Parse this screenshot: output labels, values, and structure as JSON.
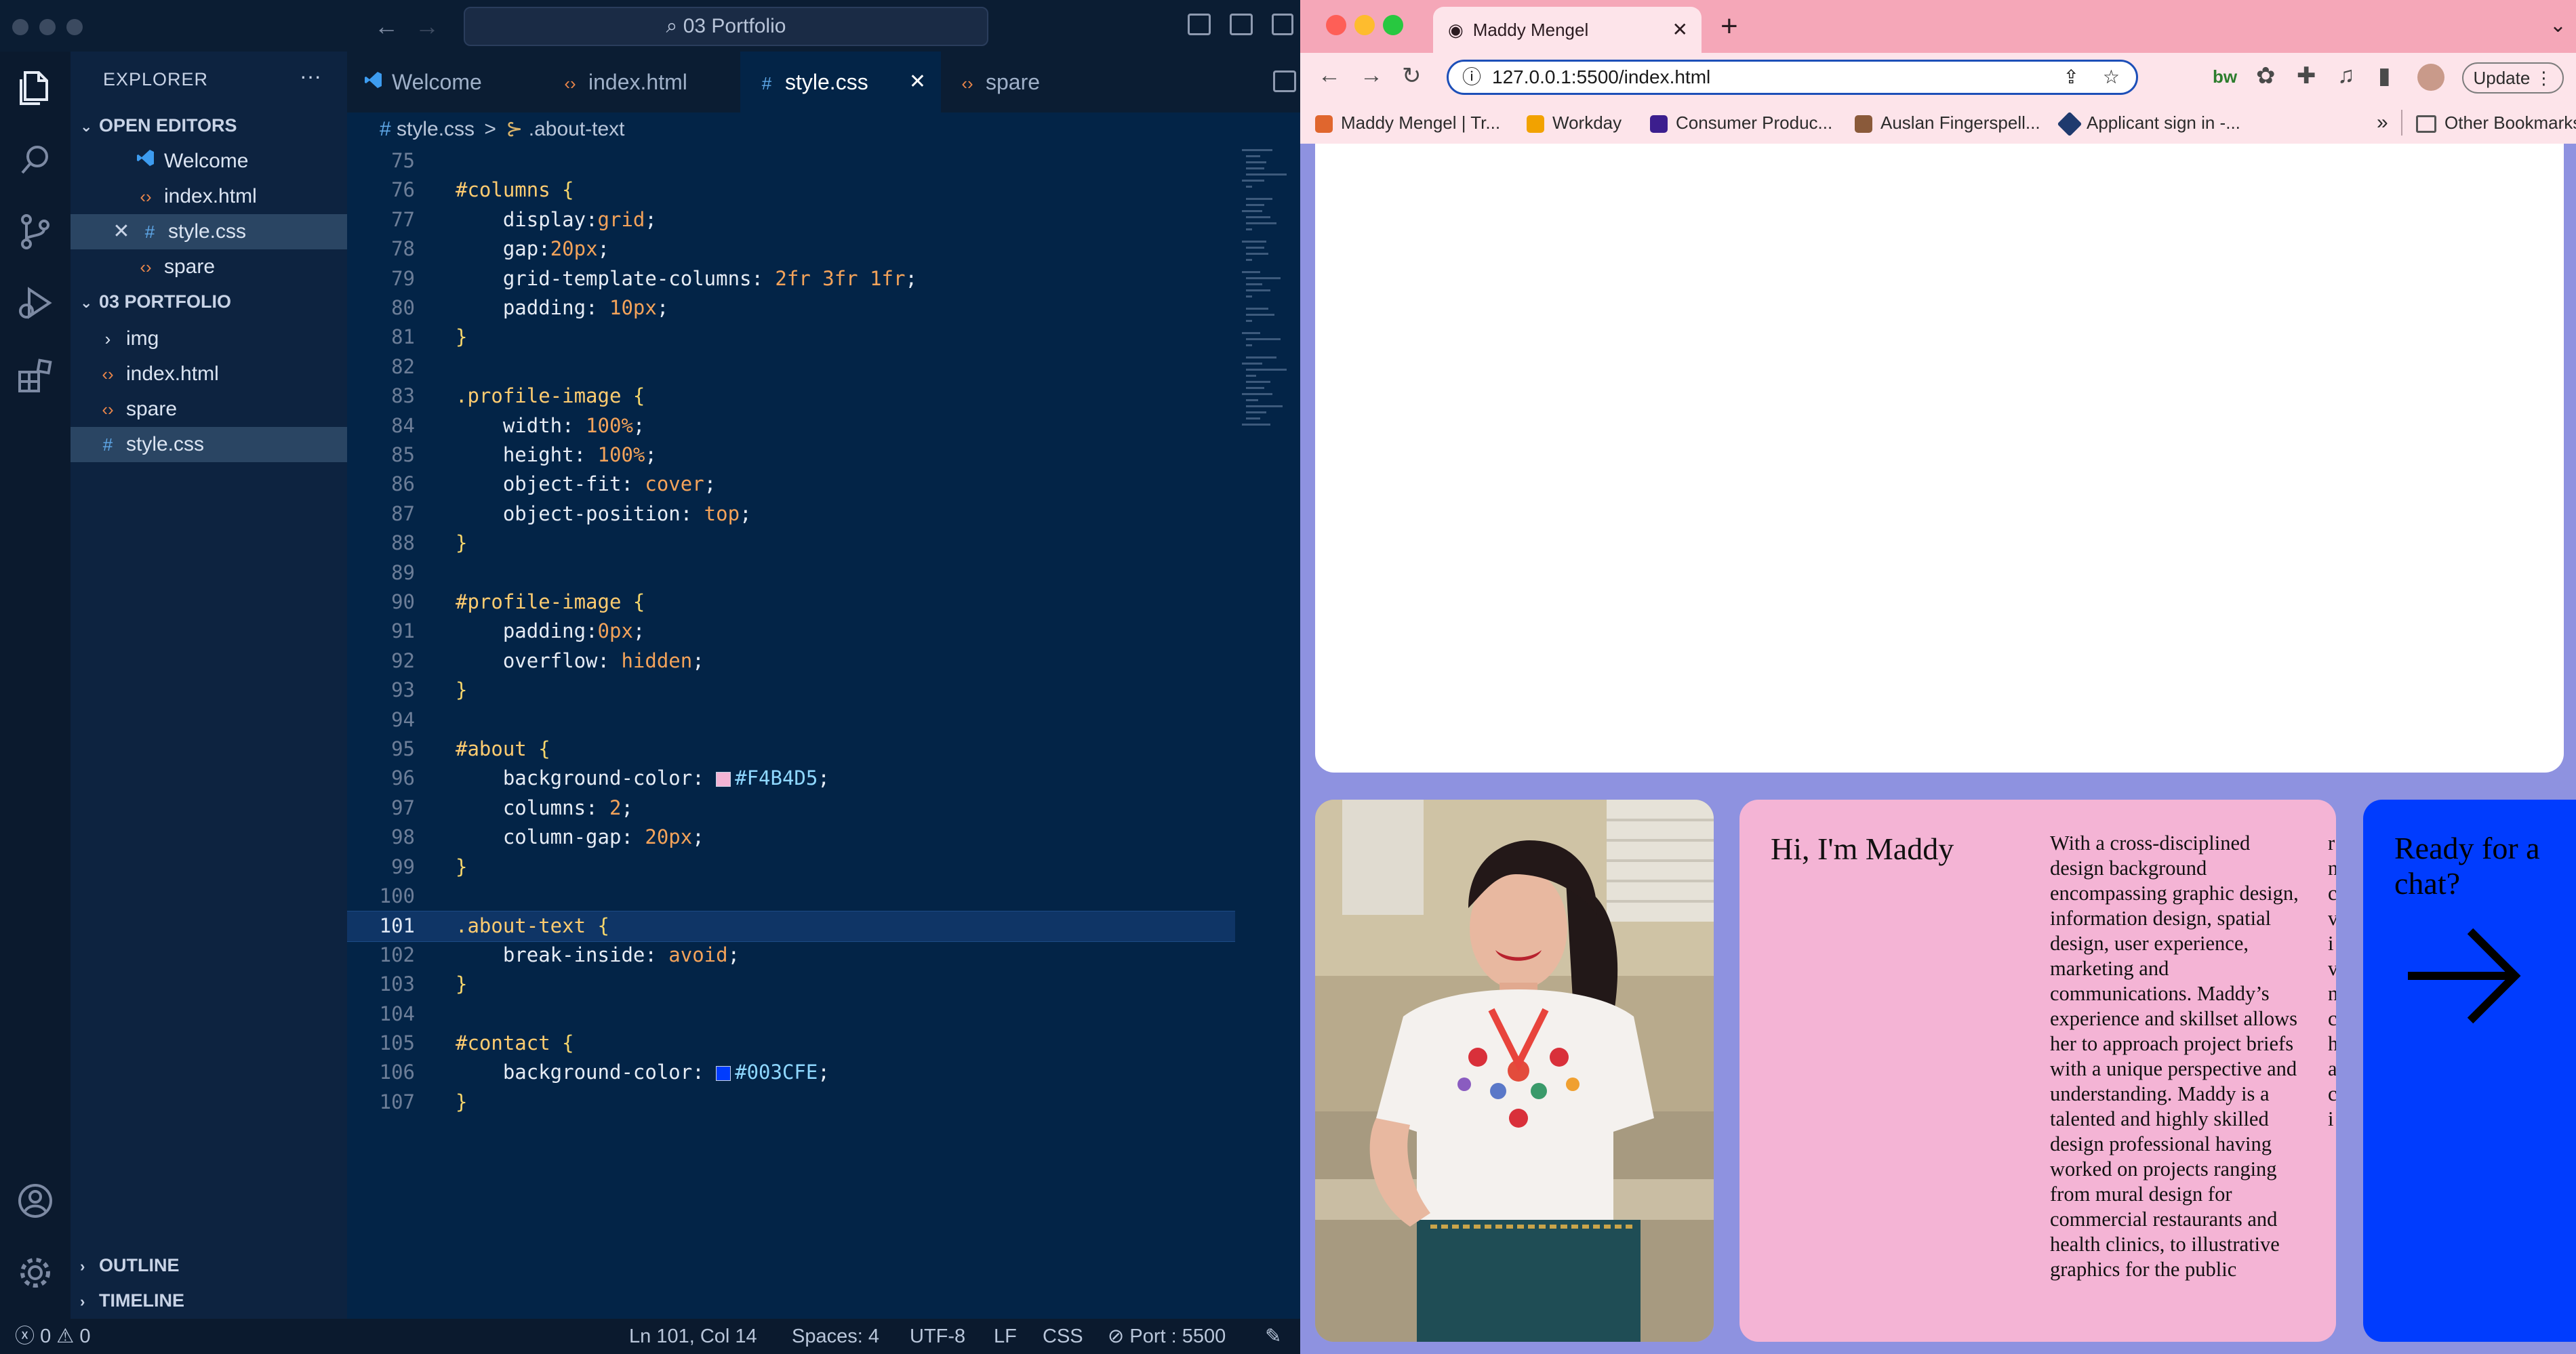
{
  "vscode": {
    "title": "03 Portfolio",
    "explorer_title": "EXPLORER",
    "open_editors_label": "OPEN EDITORS",
    "open_editors": [
      {
        "name": "Welcome",
        "icon": "vscode-logo-icon"
      },
      {
        "name": "index.html",
        "icon": "html-icon"
      },
      {
        "name": "style.css",
        "icon": "css-icon"
      },
      {
        "name": "spare",
        "icon": "html-icon"
      }
    ],
    "folder_label": "03 PORTFOLIO",
    "files": [
      {
        "name": "img",
        "type": "folder"
      },
      {
        "name": "index.html",
        "type": "html"
      },
      {
        "name": "spare",
        "type": "html"
      },
      {
        "name": "style.css",
        "type": "css"
      }
    ],
    "outline_label": "OUTLINE",
    "timeline_label": "TIMELINE",
    "tabs": [
      {
        "label": "Welcome"
      },
      {
        "label": "index.html"
      },
      {
        "label": "style.css"
      },
      {
        "label": "spare"
      }
    ],
    "breadcrumb": {
      "file": "style.css",
      "sep": ">",
      "symbol": ".about-text"
    },
    "code_lines": [
      {
        "n": "75",
        "html": ""
      },
      {
        "n": "76",
        "html": "<span class='sel-c'>#columns</span> <span class='brace'>{</span>"
      },
      {
        "n": "77",
        "html": "    <span class='prop'>display</span><span class='punct'>:</span><span class='val'>grid</span><span class='punct'>;</span>"
      },
      {
        "n": "78",
        "html": "    <span class='prop'>gap</span><span class='punct'>:</span><span class='num'>20px</span><span class='punct'>;</span>"
      },
      {
        "n": "79",
        "html": "    <span class='prop'>grid-template-columns</span><span class='punct'>: </span><span class='num'>2fr 3fr 1fr</span><span class='punct'>;</span>"
      },
      {
        "n": "80",
        "html": "    <span class='prop'>padding</span><span class='punct'>: </span><span class='num'>10px</span><span class='punct'>;</span>"
      },
      {
        "n": "81",
        "html": "<span class='brace'>}</span>"
      },
      {
        "n": "82",
        "html": ""
      },
      {
        "n": "83",
        "html": "<span class='sel-c'>.profile-image</span> <span class='brace'>{</span>"
      },
      {
        "n": "84",
        "html": "    <span class='prop'>width</span><span class='punct'>: </span><span class='num'>100%</span><span class='punct'>;</span>"
      },
      {
        "n": "85",
        "html": "    <span class='prop'>height</span><span class='punct'>: </span><span class='num'>100%</span><span class='punct'>;</span>"
      },
      {
        "n": "86",
        "html": "    <span class='prop'>object-fit</span><span class='punct'>: </span><span class='val'>cover</span><span class='punct'>;</span>"
      },
      {
        "n": "87",
        "html": "    <span class='prop'>object-position</span><span class='punct'>: </span><span class='val'>top</span><span class='punct'>;</span>"
      },
      {
        "n": "88",
        "html": "<span class='brace'>}</span>"
      },
      {
        "n": "89",
        "html": ""
      },
      {
        "n": "90",
        "html": "<span class='sel-c'>#profile-image</span> <span class='brace'>{</span>"
      },
      {
        "n": "91",
        "html": "    <span class='prop'>padding</span><span class='punct'>:</span><span class='num'>0px</span><span class='punct'>;</span>"
      },
      {
        "n": "92",
        "html": "    <span class='prop'>overflow</span><span class='punct'>: </span><span class='val'>hidden</span><span class='punct'>;</span>"
      },
      {
        "n": "93",
        "html": "<span class='brace'>}</span>"
      },
      {
        "n": "94",
        "html": ""
      },
      {
        "n": "95",
        "html": "<span class='sel-c'>#about</span> <span class='brace'>{</span>"
      },
      {
        "n": "96",
        "html": "    <span class='prop'>background-color</span><span class='punct'>: </span><span class='swatch' style='background:#F4B4D5'></span><span class='hex'>#F4B4D5</span><span class='punct'>;</span>"
      },
      {
        "n": "97",
        "html": "    <span class='prop'>columns</span><span class='punct'>: </span><span class='num'>2</span><span class='punct'>;</span>"
      },
      {
        "n": "98",
        "html": "    <span class='prop'>column-gap</span><span class='punct'>: </span><span class='num'>20px</span><span class='punct'>;</span>"
      },
      {
        "n": "99",
        "html": "<span class='brace'>}</span>"
      },
      {
        "n": "100",
        "html": ""
      },
      {
        "n": "101",
        "html": "<span class='sel-c'>.about-text</span> <span class='brace'>{</span>"
      },
      {
        "n": "102",
        "html": "    <span class='prop'>break-inside</span><span class='punct'>: </span><span class='val'>avoid</span><span class='punct'>;</span>"
      },
      {
        "n": "103",
        "html": "<span class='brace'>}</span>"
      },
      {
        "n": "104",
        "html": ""
      },
      {
        "n": "105",
        "html": "<span class='sel-c'>#contact</span> <span class='brace'>{</span>"
      },
      {
        "n": "106",
        "html": "    <span class='prop'>background-color</span><span class='punct'>: </span><span class='swatch' style='background:#003CFE'></span><span class='hex'>#003CFE</span><span class='punct'>;</span>"
      },
      {
        "n": "107",
        "html": "<span class='brace'>}</span>"
      }
    ],
    "current_line": "101",
    "status": {
      "errors": "0",
      "warnings": "0",
      "position": "Ln 101, Col 14",
      "spaces": "Spaces: 4",
      "encoding": "UTF-8",
      "eol": "LF",
      "language": "CSS",
      "port": "Port : 5500"
    }
  },
  "browser": {
    "tab_title": "Maddy Mengel",
    "url": "127.0.0.1:5500/index.html",
    "update_label": "Update",
    "bookmarks": [
      {
        "label": "Maddy Mengel | Tr...",
        "color": "#e0662e"
      },
      {
        "label": "Workday",
        "color": "#f2a200"
      },
      {
        "label": "Consumer Produc...",
        "color": "#3c1e8e"
      },
      {
        "label": "Auslan Fingerspell...",
        "color": "#8a5a3a"
      },
      {
        "label": "Applicant sign in -...",
        "color": "#1f3a6e"
      }
    ],
    "bookmarks_more": "»",
    "other_bookmarks": "Other Bookmarks",
    "page": {
      "about_heading": "Hi, I'm Maddy",
      "about_body": "With a cross-disciplined design background encompassing graphic design, information design, spatial design, user experience, marketing and communications. Maddy’s experience and skillset allows her to approach project briefs with a unique perspective and understanding. Maddy is a talented and highly skilled design professional having worked on projects ranging from mural design for commercial restaurants and health clinics, to illustrative graphics for the public",
      "overflow_letters": [
        "r",
        "n",
        "c",
        "v",
        "i",
        "v",
        "n",
        "c",
        "h",
        "a",
        "c",
        "i"
      ],
      "contact_text": "Ready for a chat?",
      "colors": {
        "about": "#F4B4D5",
        "contact": "#003CFE",
        "page_bg": "#8E92E0"
      }
    }
  }
}
